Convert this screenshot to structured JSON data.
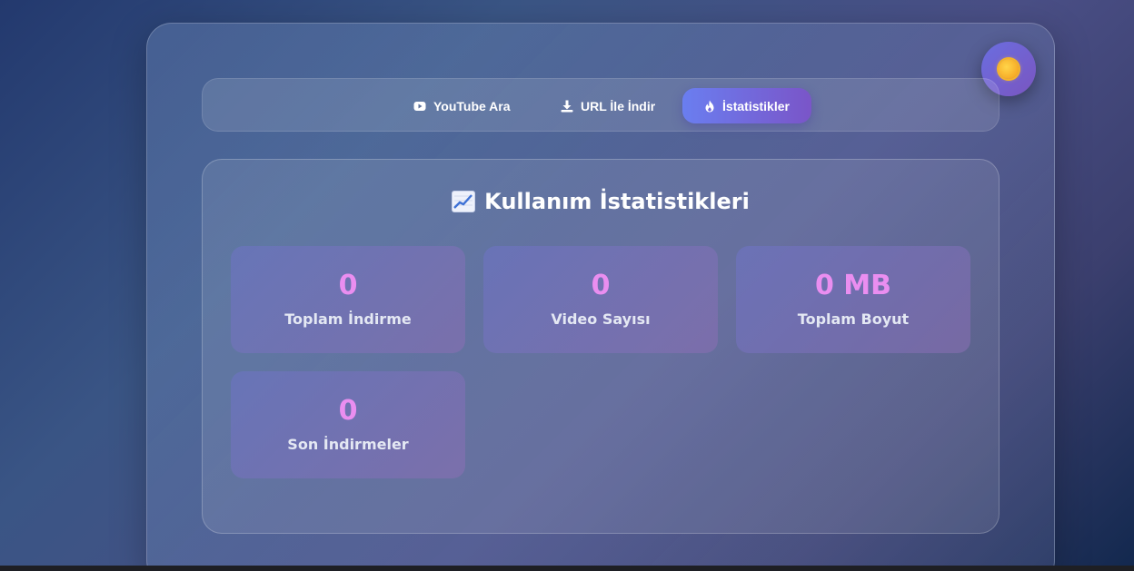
{
  "tabs": [
    {
      "label": "YouTube Ara",
      "icon": "youtube-icon"
    },
    {
      "label": "URL İle İndir",
      "icon": "download-icon"
    },
    {
      "label": "İstatistikler",
      "icon": "fire-icon",
      "active": true
    }
  ],
  "theme_toggle": {
    "icon": "sun-icon"
  },
  "stats": {
    "title": "Kullanım İstatistikleri",
    "title_icon": "chart-icon",
    "cards": [
      {
        "value": "0",
        "label": "Toplam İndirme"
      },
      {
        "value": "0",
        "label": "Video Sayısı"
      },
      {
        "value": "0 MB",
        "label": "Toplam Boyut"
      },
      {
        "value": "0",
        "label": "Son İndirmeler"
      }
    ]
  },
  "colors": {
    "accent_start": "#6a7ef0",
    "accent_end": "#7a55c8",
    "stat_value": "#ea8ef0"
  }
}
